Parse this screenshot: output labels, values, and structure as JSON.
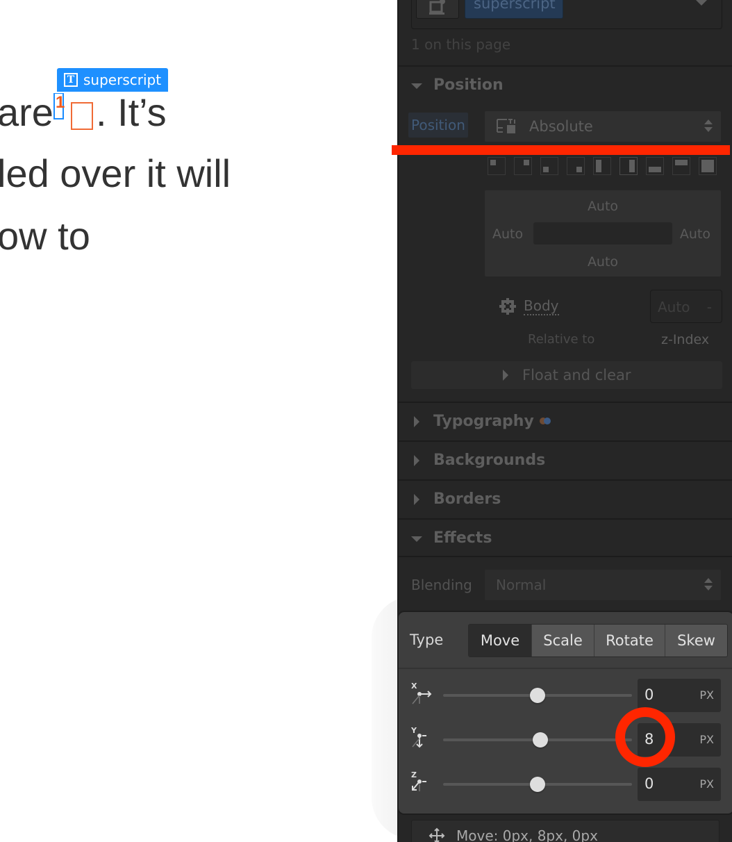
{
  "canvas": {
    "line1_before": "are",
    "superscript_text": "1",
    "line1_after": ". It’s",
    "line2": "led over it will",
    "line3": "ow to",
    "selection_label": "superscript",
    "selection_icon": "text-block-icon",
    "colors": {
      "selection": "#1e90ff",
      "orange_marker": "#f06a35",
      "text": "#333333"
    }
  },
  "panel": {
    "selector": {
      "class_chip": "superscript",
      "icon": "element-icon",
      "dropdown_icon": "chevron-down-icon"
    },
    "usage_count": "1 on this page",
    "sections": {
      "position": {
        "title": "Position",
        "expanded": true
      },
      "typography": {
        "title": "Typography",
        "expanded": false
      },
      "backgrounds": {
        "title": "Backgrounds",
        "expanded": false
      },
      "borders": {
        "title": "Borders",
        "expanded": false
      },
      "effects": {
        "title": "Effects",
        "expanded": true
      }
    },
    "position": {
      "label": "Position",
      "value": "Absolute",
      "presets": [
        "top-left",
        "top-right",
        "bottom-left",
        "bottom-right",
        "left",
        "right",
        "bottom",
        "top",
        "full"
      ],
      "active_preset": "right",
      "box": {
        "top": "Auto",
        "right": "Auto",
        "bottom": "Auto",
        "left": "Auto"
      },
      "relative_to_value": "Body",
      "relative_to_label": "Relative to",
      "zindex_value": "Auto",
      "zindex_dash": "-",
      "zindex_label": "z-Index",
      "float_clear": "Float and clear"
    },
    "effects": {
      "blending_label": "Blending",
      "blending_value": "Normal"
    }
  },
  "transform_popup": {
    "type_label": "Type",
    "types": [
      "Move",
      "Scale",
      "Rotate",
      "Skew"
    ],
    "active_type": "Move",
    "axes": [
      {
        "axis": "X",
        "value": "0",
        "unit": "PX",
        "slider_fraction": 0.5
      },
      {
        "axis": "Y",
        "value": "8",
        "unit": "PX",
        "slider_fraction": 0.515
      },
      {
        "axis": "Z",
        "value": "0",
        "unit": "PX",
        "slider_fraction": 0.5
      }
    ],
    "summary": "Move: 0px, 8px, 0px"
  },
  "annotations": {
    "color": "#ff2600",
    "highlighted_field": "Y value"
  }
}
